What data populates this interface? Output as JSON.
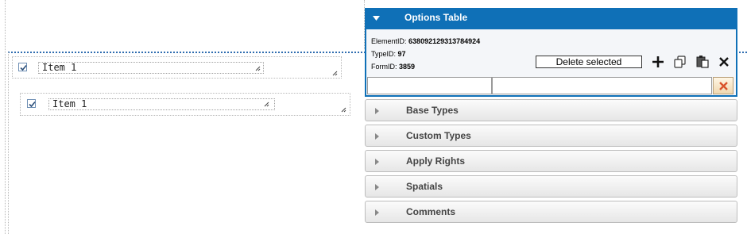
{
  "items": [
    {
      "checked": true,
      "text": "Item 1"
    },
    {
      "checked": true,
      "text": "Item 1"
    }
  ],
  "options": {
    "title": "Options Table",
    "element_id_label": "ElementID:",
    "element_id": "638092129313784924",
    "type_id_label": "TypeID:",
    "type_id": "97",
    "form_id_label": "FormID:",
    "form_id": "3859",
    "delete_label": "Delete selected",
    "filter1": "",
    "filter2": ""
  },
  "sections": [
    {
      "label": "Base Types"
    },
    {
      "label": "Custom Types"
    },
    {
      "label": "Apply Rights"
    },
    {
      "label": "Spatials"
    },
    {
      "label": "Comments"
    }
  ],
  "colors": {
    "header_blue": "#0f70b7",
    "guide_blue": "#2f6db0",
    "clear_red": "#d9532c"
  },
  "icons": [
    "collapse-triangle-icon",
    "add-icon",
    "copy-icon",
    "paste-icon",
    "close-icon",
    "clear-icon",
    "expand-triangle-icon"
  ]
}
